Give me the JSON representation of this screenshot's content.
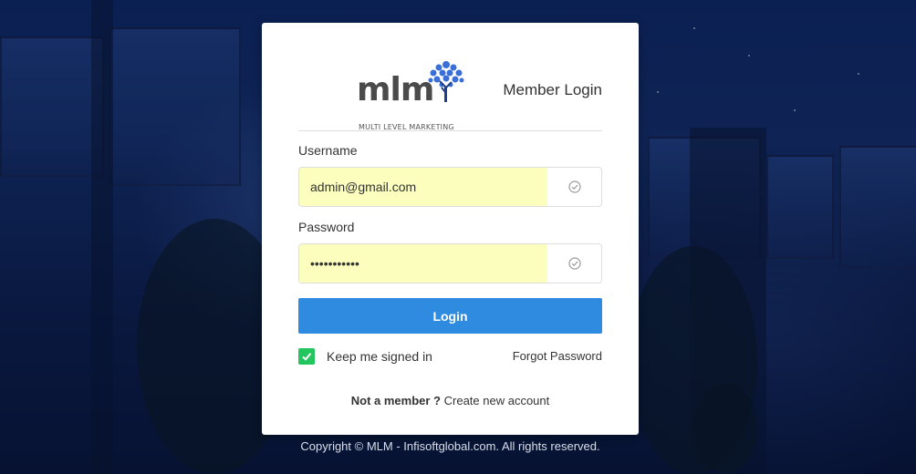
{
  "brand": {
    "logo_text": "mlm",
    "logo_subtitle": "MULTI LEVEL MARKETING",
    "logo_color": "#4a4a4a",
    "tree_color": "#3a6fd8"
  },
  "login": {
    "title": "Member Login",
    "username_label": "Username",
    "username_value": "admin@gmail.com",
    "password_label": "Password",
    "password_value": "•••••••••••",
    "submit_label": "Login",
    "remember_label": "Keep me signed in",
    "remember_checked": true,
    "forgot_label": "Forgot Password",
    "not_member_label": "Not a member ?",
    "create_account_label": "Create new account"
  },
  "footer": {
    "copyright": "Copyright © MLM - Infisoftglobal.com. All rights reserved."
  },
  "colors": {
    "accent": "#2e8be0",
    "autofill": "#fbfebd",
    "checkbox": "#22c55e"
  },
  "icons": {
    "field_status": "check-circle-icon",
    "remember": "check-icon"
  }
}
